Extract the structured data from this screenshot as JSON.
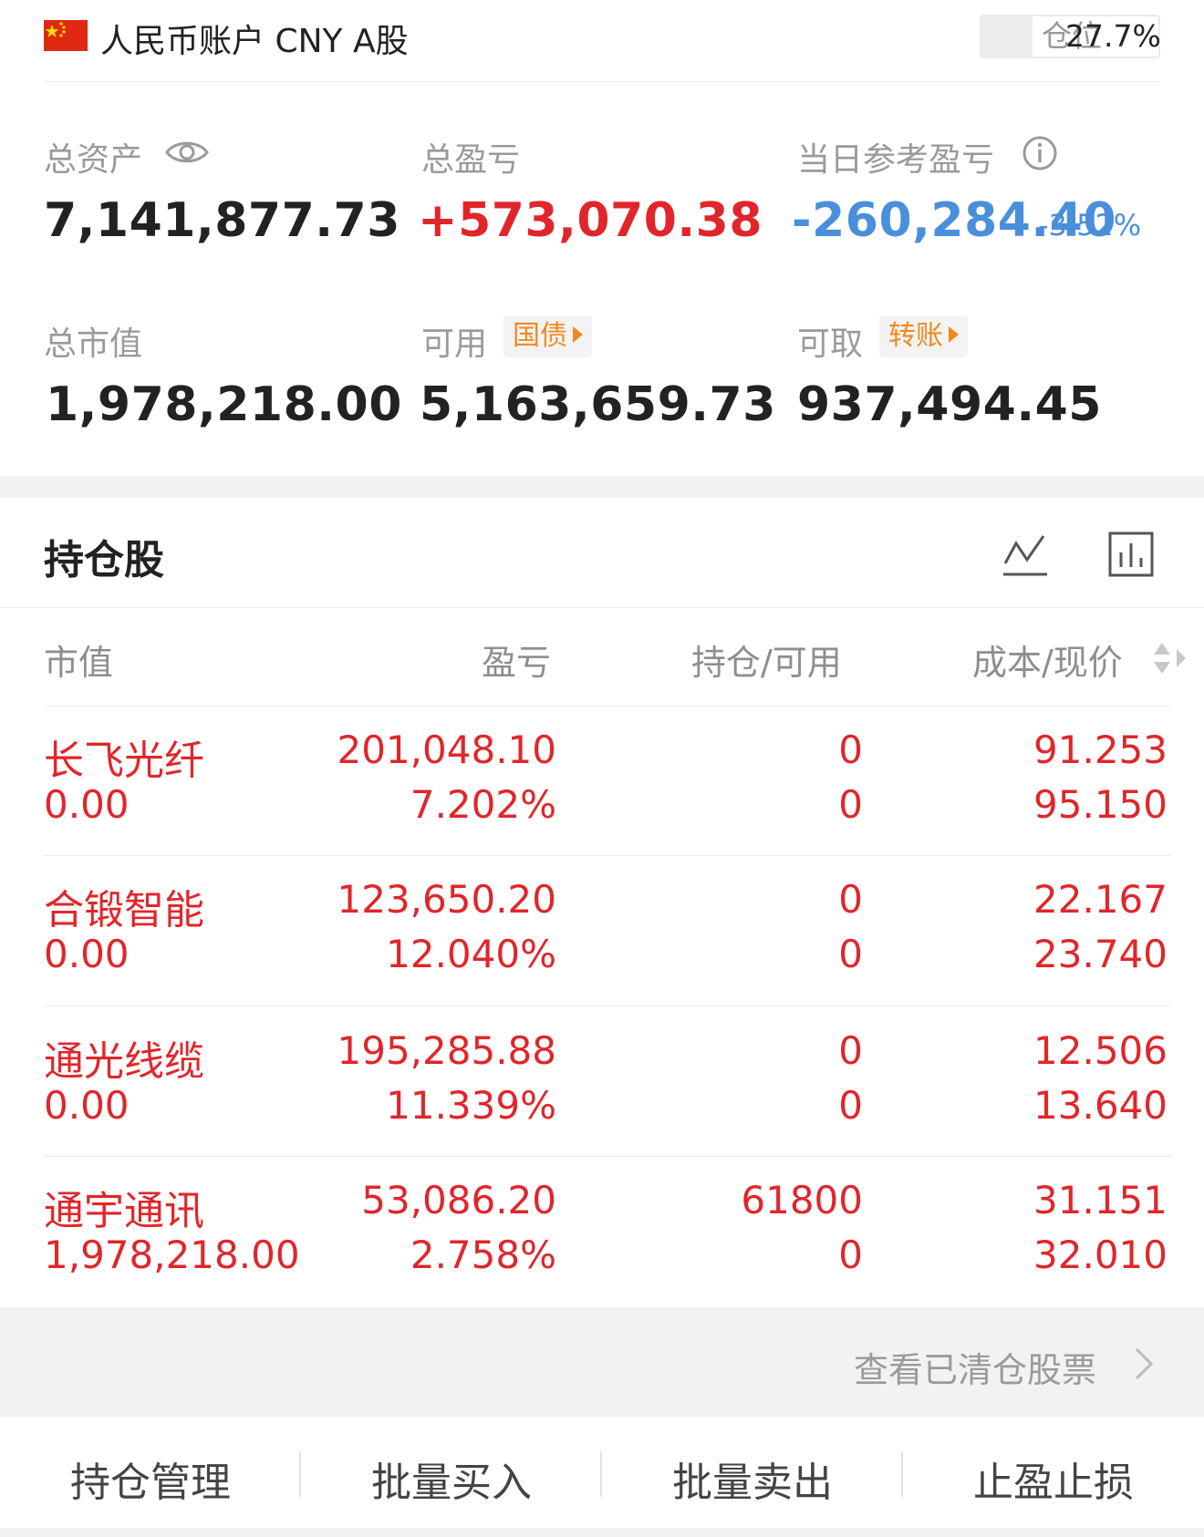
{
  "account": {
    "flag": "china-flag",
    "title": "人民币账户 CNY A股",
    "position_label": "仓位",
    "position_value": "27.7%"
  },
  "summary": {
    "total_assets_label": "总资产",
    "total_assets_value": "7,141,877.73",
    "total_pnl_label": "总盈亏",
    "total_pnl_value": "+573,070.38",
    "daily_pnl_label": "当日参考盈亏",
    "daily_pnl_value": "-260,284.40",
    "daily_pnl_pct": "-3.52%",
    "market_value_label": "总市值",
    "market_value_value": "1,978,218.00",
    "available_label": "可用",
    "available_tag": "国债",
    "available_value": "5,163,659.73",
    "withdrawable_label": "可取",
    "withdrawable_tag": "转账",
    "withdrawable_value": "937,494.45"
  },
  "holdings": {
    "title": "持仓股",
    "columns": [
      "市值",
      "盈亏",
      "持仓/可用",
      "成本/现价"
    ],
    "rows": [
      {
        "name": "长飞光纤",
        "market_value": "0.00",
        "pnl": "201,048.10",
        "pnl_pct": "7.202%",
        "hold": "0",
        "avail": "0",
        "cost": "91.253",
        "price": "95.150"
      },
      {
        "name": "合锻智能",
        "market_value": "0.00",
        "pnl": "123,650.20",
        "pnl_pct": "12.040%",
        "hold": "0",
        "avail": "0",
        "cost": "22.167",
        "price": "23.740"
      },
      {
        "name": "通光线缆",
        "market_value": "0.00",
        "pnl": "195,285.88",
        "pnl_pct": "11.339%",
        "hold": "0",
        "avail": "0",
        "cost": "12.506",
        "price": "13.640"
      },
      {
        "name": "通宇通讯",
        "market_value": "1,978,218.00",
        "pnl": "53,086.20",
        "pnl_pct": "2.758%",
        "hold": "61800",
        "avail": "0",
        "cost": "31.151",
        "price": "32.010"
      }
    ],
    "cleared_link": "查看已清仓股票"
  },
  "actions": [
    "持仓管理",
    "批量买入",
    "批量卖出",
    "止盈止损"
  ],
  "colors": {
    "profit_red": "#e0262b",
    "loss_blue": "#4a8fdb",
    "tag_orange": "#f08a1e"
  }
}
